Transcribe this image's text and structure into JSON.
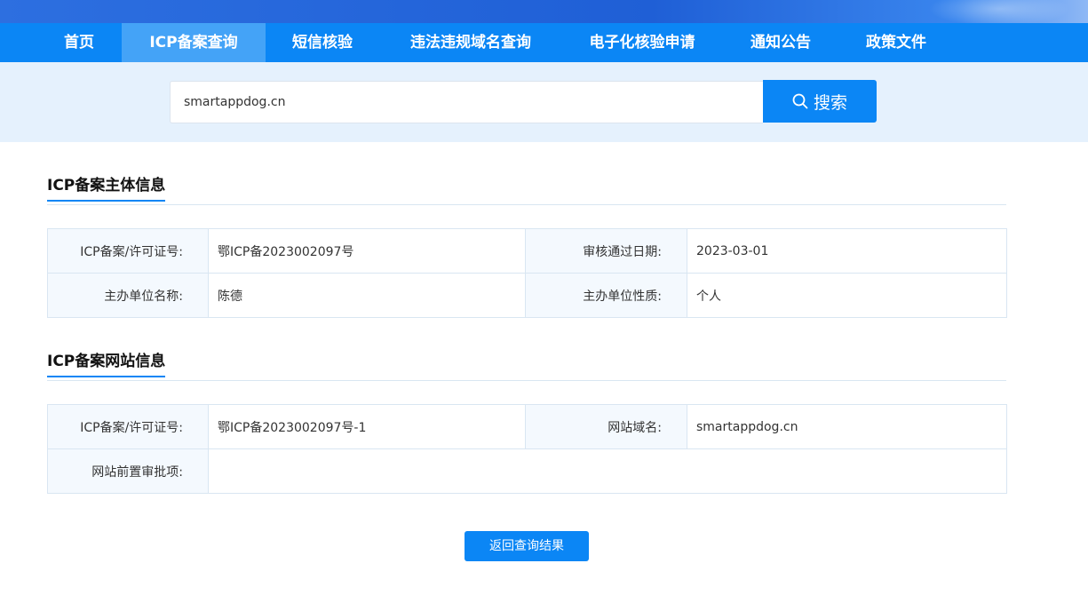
{
  "nav": {
    "items": [
      {
        "label": "首页"
      },
      {
        "label": "ICP备案查询"
      },
      {
        "label": "短信核验"
      },
      {
        "label": "违法违规域名查询"
      },
      {
        "label": "电子化核验申请"
      },
      {
        "label": "通知公告"
      },
      {
        "label": "政策文件"
      }
    ],
    "active_index": 1
  },
  "search": {
    "value": "smartappdog.cn",
    "button_label": "搜索",
    "icon": "search-icon"
  },
  "subject_section": {
    "title": "ICP备案主体信息",
    "rows": [
      {
        "label1": "ICP备案/许可证号:",
        "value1": "鄂ICP备2023002097号",
        "label2": "审核通过日期:",
        "value2": "2023-03-01"
      },
      {
        "label1": "主办单位名称:",
        "value1": "陈德",
        "label2": "主办单位性质:",
        "value2": "个人"
      }
    ]
  },
  "website_section": {
    "title": "ICP备案网站信息",
    "rows": [
      {
        "label1": "ICP备案/许可证号:",
        "value1": "鄂ICP备2023002097号-1",
        "label2": "网站域名:",
        "value2": "smartappdog.cn"
      },
      {
        "label1": "网站前置审批项:",
        "value1": ""
      }
    ]
  },
  "back_button_label": "返回查询结果",
  "colors": {
    "accent": "#0b86f5",
    "nav_active": "#44a3f7",
    "search_band": "#e5f1fd"
  }
}
